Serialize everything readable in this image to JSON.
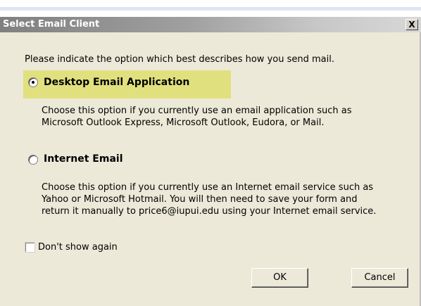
{
  "window": {
    "title": "Select Email Client",
    "close_glyph": "X"
  },
  "dialog": {
    "instruction": "Please indicate the option which best describes how you send mail.",
    "options": [
      {
        "label": "Desktop Email Application",
        "selected": true,
        "description_lines": [
          "Choose this option if you currently use an email application such as",
          "Microsoft Outlook Express, Microsoft Outlook, Eudora, or Mail."
        ]
      },
      {
        "label": "Internet Email",
        "selected": false,
        "description_lines": [
          "Choose this option if you currently use an Internet email service such as",
          "Yahoo or Microsoft Hotmail. You will then need to save your form and",
          "return it manually to price6@iupui.edu using your Internet email service."
        ]
      }
    ],
    "dont_show_again": {
      "label": "Don't show again",
      "checked": false
    },
    "buttons": {
      "ok": "OK",
      "cancel": "Cancel"
    }
  },
  "colors": {
    "highlight": "#e1e07e",
    "dialog_background": "#ece9d8",
    "titlebar_start": "#808080",
    "titlebar_end": "#d8d8d8"
  },
  "icons": {
    "close": "close-icon",
    "radio": "radio-button-icon",
    "checkbox": "checkbox-icon"
  }
}
